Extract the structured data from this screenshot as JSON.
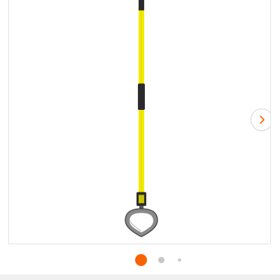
{
  "gallery": {
    "product_image_icon": "hoe-tool-icon",
    "next_button_icon": "chevron-right-icon",
    "accent_color": "#f96302",
    "pagination": {
      "total_dots": 3,
      "active_index": 0
    }
  },
  "colors": {
    "handle_yellow": "#f2ea00",
    "grip_dark": "#2b2b2d",
    "blade_gray": "#7c7c7c",
    "dot_inactive": "#c7c7c7",
    "border": "#e5e5e5"
  }
}
